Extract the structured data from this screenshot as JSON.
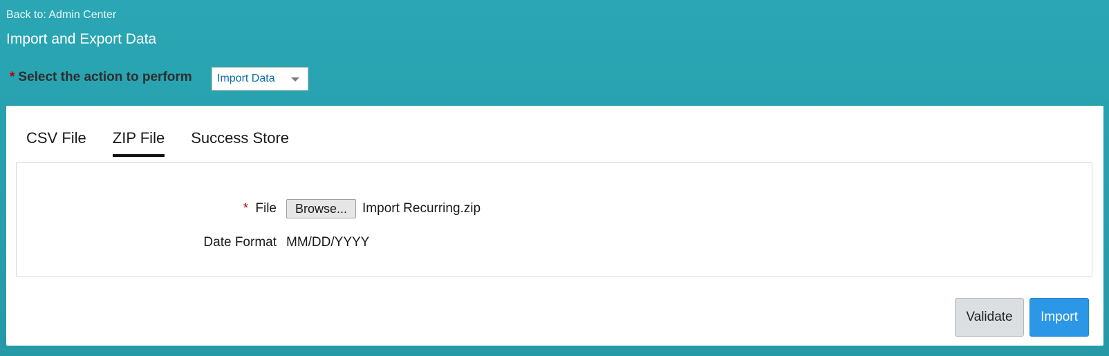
{
  "header": {
    "back_link": "Back to: Admin Center",
    "title": "Import and Export Data"
  },
  "action": {
    "required_marker": "*",
    "label": "Select the action to perform",
    "selected": "Import Data"
  },
  "tabs": [
    {
      "label": "CSV File",
      "active": false
    },
    {
      "label": "ZIP File",
      "active": true
    },
    {
      "label": "Success Store",
      "active": false
    }
  ],
  "form": {
    "file": {
      "required_marker": "*",
      "label": "File",
      "browse_label": "Browse...",
      "filename": "Import Recurring.zip"
    },
    "date_format": {
      "label": "Date Format",
      "value": "MM/DD/YYYY"
    }
  },
  "buttons": {
    "validate": "Validate",
    "import": "Import"
  },
  "colors": {
    "background": "#2aa6b4",
    "primary_button": "#2b97e6",
    "required": "#bb0000"
  }
}
